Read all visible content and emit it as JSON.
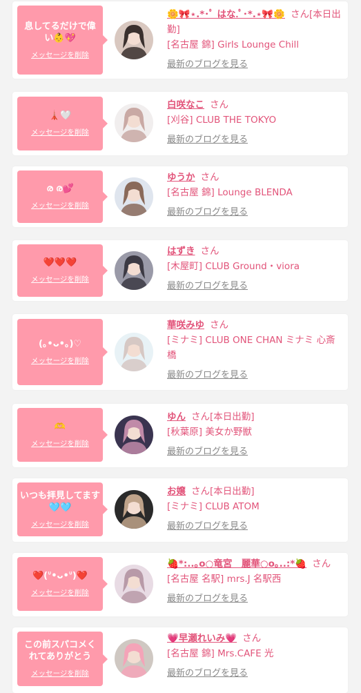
{
  "entries": [
    {
      "message": "息してるだけで偉い👶💖",
      "delete_label": "メッセージを削除",
      "name": "🌼🎀⋆.*･ﾟ はな.ﾟ･*.⋆🎀🌼",
      "san": "さん",
      "status": "[本日出勤]",
      "shop": "[名古屋 錦] Girls Lounge Chill",
      "blog": "最新のブログを見る",
      "avatar_colors": [
        "#d9c8c0",
        "#3a302e"
      ]
    },
    {
      "message": "🗼🤍",
      "delete_label": "メッセージを削除",
      "name": "白咲なこ",
      "san": "さん",
      "status": "",
      "shop": "[刈谷] CLUB THE TOKYO",
      "blog": "最新のブログを見る",
      "avatar_colors": [
        "#f1eeee",
        "#c9a9a4"
      ]
    },
    {
      "message": "ര ര💕",
      "delete_label": "メッセージを削除",
      "name": "ゆうか",
      "san": "さん",
      "status": "",
      "shop": "[名古屋 錦] Lounge BLENDA",
      "blog": "最新のブログを見る",
      "avatar_colors": [
        "#dfe5ee",
        "#8a6a5a"
      ]
    },
    {
      "message": "❤️❤️❤️",
      "delete_label": "メッセージを削除",
      "name": "はずき",
      "san": "さん",
      "status": "",
      "shop": "[木屋町] CLUB Ground・viora",
      "blog": "最新のブログを見る",
      "avatar_colors": [
        "#9a9aa8",
        "#3c3a44"
      ]
    },
    {
      "message": "(｡•ᴗ•｡)♡",
      "delete_label": "メッセージを削除",
      "name": "華咲みゆ",
      "san": "さん",
      "status": "",
      "shop": "[ミナミ] CLUB ONE CHAN ミナミ 心斎橋",
      "blog": "最新のブログを見る",
      "avatar_colors": [
        "#e8f2f6",
        "#d6c8c4"
      ]
    },
    {
      "message": "🫶",
      "delete_label": "メッセージを削除",
      "name": "ゆん",
      "san": "さん",
      "status": "[本日出勤]",
      "shop": "[秋葉原] 美女か野獣",
      "blog": "最新のブログを見る",
      "avatar_colors": [
        "#3a3450",
        "#c08aa8"
      ]
    },
    {
      "message": "いつも拝見してます🩵🩵",
      "delete_label": "メッセージを削除",
      "name": "お嬢",
      "san": "さん",
      "status": "[本日出勤]",
      "shop": "[ミナミ] CLUB ATOM",
      "blog": "最新のブログを見る",
      "avatar_colors": [
        "#2a2a2a",
        "#bfa38a"
      ]
    },
    {
      "message": "❤️(ᐡ•ᴗ•ᐡ)❤️",
      "delete_label": "メッセージを削除",
      "name": "🍓*:..｡o○竜宮　麗華○o｡..:*🍓",
      "san": "さん",
      "status": "",
      "shop": "[名古屋 名駅] mrs.J 名駅西",
      "blog": "最新のブログを見る",
      "avatar_colors": [
        "#e8dbe4",
        "#b89aa8"
      ]
    },
    {
      "message": "この前スパコメくれてありがとう",
      "delete_label": "メッセージを削除",
      "name": "💗早瀬れいみ💗",
      "san": "さん",
      "status": "",
      "shop": "[名古屋 錦] Mrs.CAFE 光",
      "blog": "最新のブログを見る",
      "avatar_colors": [
        "#cfc8c2",
        "#f4a4b8"
      ]
    }
  ]
}
